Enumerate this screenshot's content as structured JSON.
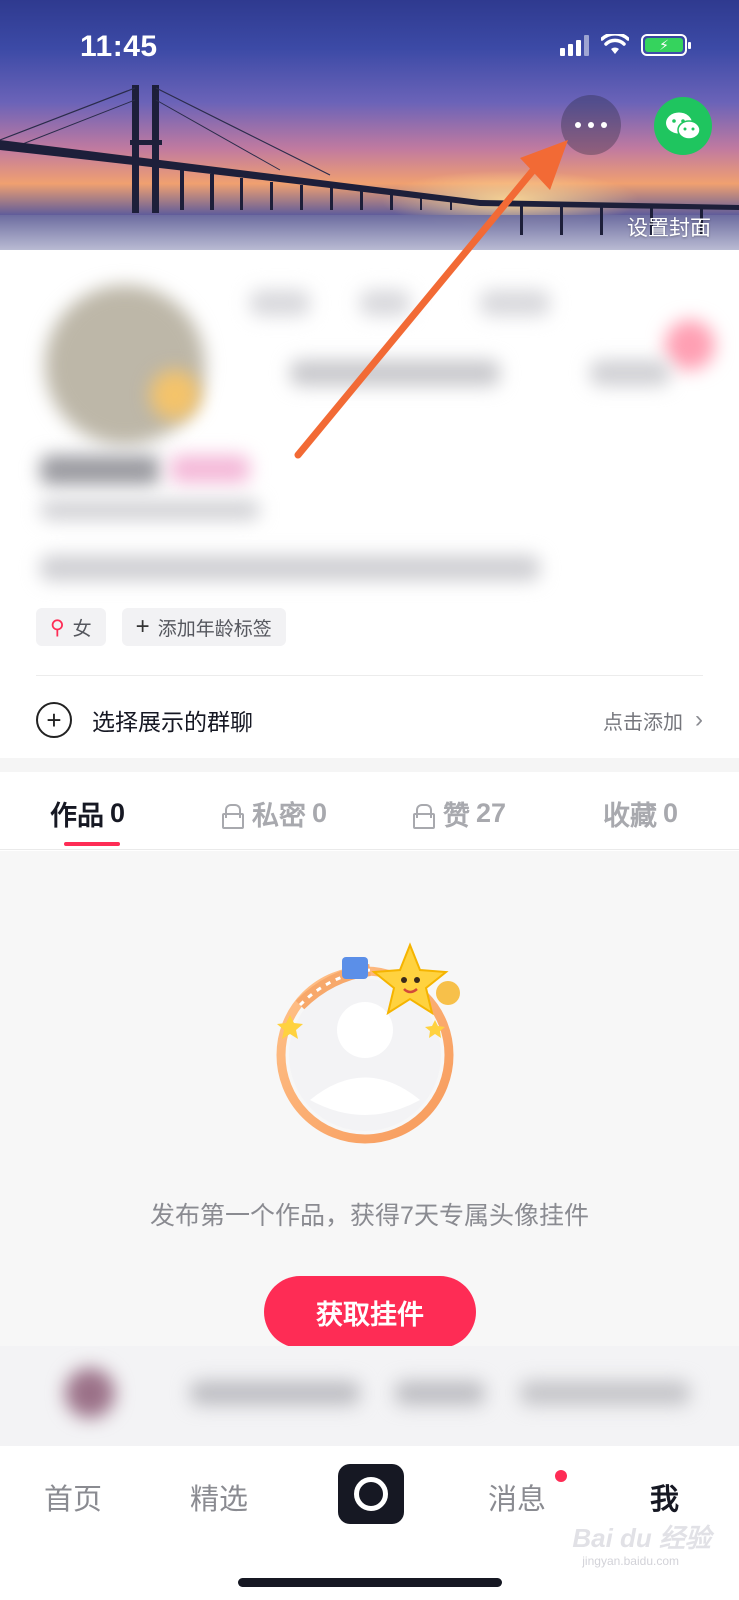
{
  "status_bar": {
    "time": "11:45"
  },
  "header": {
    "set_cover_label": "设置封面"
  },
  "profile": {
    "tags": {
      "gender": "女",
      "add_age": "添加年龄标签"
    }
  },
  "group_chat": {
    "label": "选择展示的群聊",
    "action": "点击添加"
  },
  "tabs": [
    {
      "label": "作品",
      "count": "0"
    },
    {
      "label": "私密",
      "count": "0"
    },
    {
      "label": "赞",
      "count": "27"
    },
    {
      "label": "收藏",
      "count": "0"
    }
  ],
  "empty_state": {
    "message": "发布第一个作品，获得7天专属头像挂件",
    "button_label": "获取挂件"
  },
  "bottom_nav": {
    "home": "首页",
    "featured": "精选",
    "messages": "消息",
    "me": "我"
  },
  "watermark": {
    "text": "Bai du 经验",
    "sub": "jingyan.baidu.com"
  },
  "colors": {
    "accent": "#fe2c55",
    "wechat": "#1fc55f",
    "annotation_arrow": "#f26a35"
  },
  "icons": [
    "more-icon",
    "wechat-icon",
    "gender-female-icon",
    "plus-icon",
    "circle-plus-icon",
    "chevron-right-icon",
    "lock-icon",
    "camera-icon"
  ]
}
